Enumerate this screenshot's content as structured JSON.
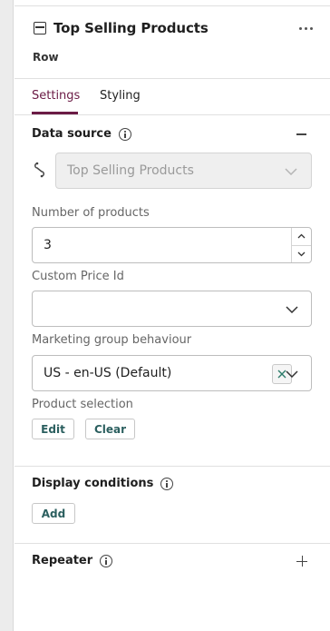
{
  "header": {
    "title": "Top Selling Products",
    "subtitle": "Row",
    "more_icon": "more-horizontal-icon",
    "component_icon": "row-component-icon"
  },
  "tabs": [
    {
      "label": "Settings",
      "active": true
    },
    {
      "label": "Styling",
      "active": false
    }
  ],
  "data_source": {
    "title": "Data source",
    "collapse_icon": "minus-icon",
    "link_icon": "link-icon",
    "selected": "Top Selling Products",
    "disabled": true
  },
  "number_of_products": {
    "label": "Number of products",
    "value": "3"
  },
  "custom_price_id": {
    "label": "Custom Price Id",
    "value": ""
  },
  "marketing_group": {
    "label": "Marketing group behaviour",
    "value": "US - en-US (Default)"
  },
  "product_selection": {
    "label": "Product selection",
    "edit_label": "Edit",
    "clear_label": "Clear"
  },
  "display_conditions": {
    "title": "Display conditions",
    "add_label": "Add"
  },
  "repeater": {
    "title": "Repeater",
    "add_icon": "plus-icon"
  },
  "colors": {
    "accent": "#6b1b45",
    "button_text": "#2b5f5f",
    "clear_x": "#2e7d6b"
  }
}
